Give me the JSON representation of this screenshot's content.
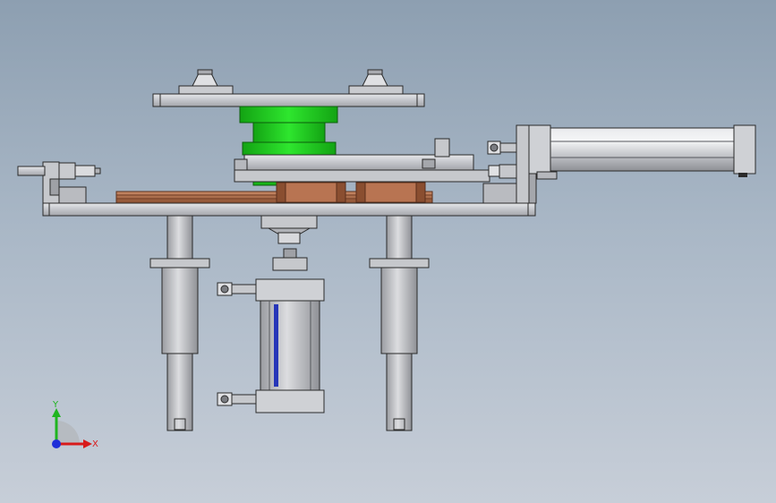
{
  "view": {
    "background_top": "#8d9fb1",
    "background_bottom": "#c7ced8"
  },
  "colors": {
    "steel_light": "#d4d6da",
    "steel_mid": "#b6b8bd",
    "steel_dark": "#8c8e93",
    "edge": "#2a2a2a",
    "wheel_green": "#1fd11f",
    "wheel_green_dark": "#13a313",
    "rail_copper": "#b5734f",
    "rail_copper_dark": "#8a4e30",
    "piston_blue": "#2636b8",
    "axis_x": "#d81b1b",
    "axis_y": "#1fb51f",
    "axis_z": "#1f2fd8"
  },
  "triad": {
    "x_label": "X",
    "y_label": "Y"
  }
}
